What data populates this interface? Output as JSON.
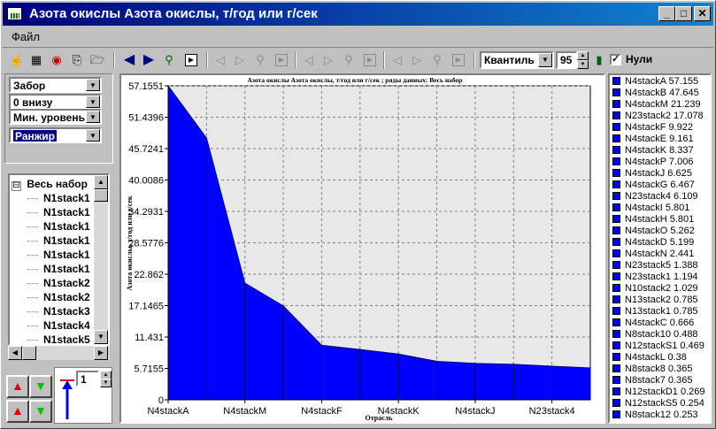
{
  "window": {
    "title": "Азота окислы Азота окислы,  т/год или г/сек",
    "min_icon": "minimize-icon",
    "max_icon": "maximize-icon",
    "close_icon": "close-icon"
  },
  "menu": {
    "file": "Файл"
  },
  "toolbar": {
    "stat_select": "Квантиль",
    "percent_value": "95",
    "zeros_label": "Нули",
    "zeros_checked": true
  },
  "left_panel": {
    "select1": "Забор",
    "select2": "0 внизу",
    "select3": "Мин. уровень",
    "select4": "Ранжир",
    "tree": {
      "root": "Весь набор",
      "root_toggle": "⊟",
      "items": [
        "N1stack1",
        "N1stack1",
        "N1stack1",
        "N1stack1",
        "N1stack1",
        "N1stack1",
        "N1stack2",
        "N1stack2",
        "N1stack3",
        "N1stack4",
        "N1stack5"
      ]
    },
    "level_value": "1"
  },
  "chart_data": {
    "type": "area",
    "title": "Азота окислы Азота окислы,  т/год или г/сек ; ряды данных: Весь набор",
    "xlabel": "Отрасль",
    "ylabel": "Азота окислы, т/год или г/сек",
    "ylim": [
      0,
      57.1551
    ],
    "grid": true,
    "y_ticks": [
      "57.1551",
      "51.4396",
      "45.7241",
      "40.0086",
      "34.2931",
      "28.5776",
      "22.862",
      "17.1465",
      "11.431",
      "5.7155",
      "0"
    ],
    "x_tick_labels": [
      "N4stackA",
      "N4stackM",
      "N4stackF",
      "N4stackK",
      "N4stackJ",
      "N23stack4"
    ],
    "categories": [
      "N4stackA",
      "N4stackB",
      "N4stackM",
      "N23stack2",
      "N4stackF",
      "N4stackE",
      "N4stackK",
      "N4stackP",
      "N4stackJ",
      "N4stackG",
      "N23stack4",
      "N4stackI"
    ],
    "values": [
      57.155,
      47.645,
      21.239,
      17.078,
      9.922,
      9.161,
      8.337,
      7.006,
      6.625,
      6.467,
      6.109,
      5.801
    ],
    "series_color": "#0000ff"
  },
  "legend": {
    "entries": [
      "N4stackA 57.155",
      "N4stackB 47.645",
      "N4stackM 21.239",
      "N23stack2 17.078",
      "N4stackF 9.922",
      "N4stackE 9.161",
      "N4stackK 8.337",
      "N4stackP 7.006",
      "N4stackJ 6.625",
      "N4stackG 6.467",
      "N23stack4 6.109",
      "N4stackI 5.801",
      "N4stackH 5.801",
      "N4stackO 5.262",
      "N4stackD 5.199",
      "N4stackN 2.441",
      "N23stack5 1.388",
      "N23stack1 1.194",
      "N10stack2 1.029",
      "N13stack2 0.785",
      "N13stack1 0.785",
      "N4stackC 0.666",
      "N8stack10 0.488",
      "N12stackS1 0.469",
      "N4stackL 0.38",
      "N8stack8 0.365",
      "N8stack7 0.365",
      "N12stackD1 0.269",
      "N12stackS5 0.254",
      "N8stack12 0.253"
    ]
  }
}
